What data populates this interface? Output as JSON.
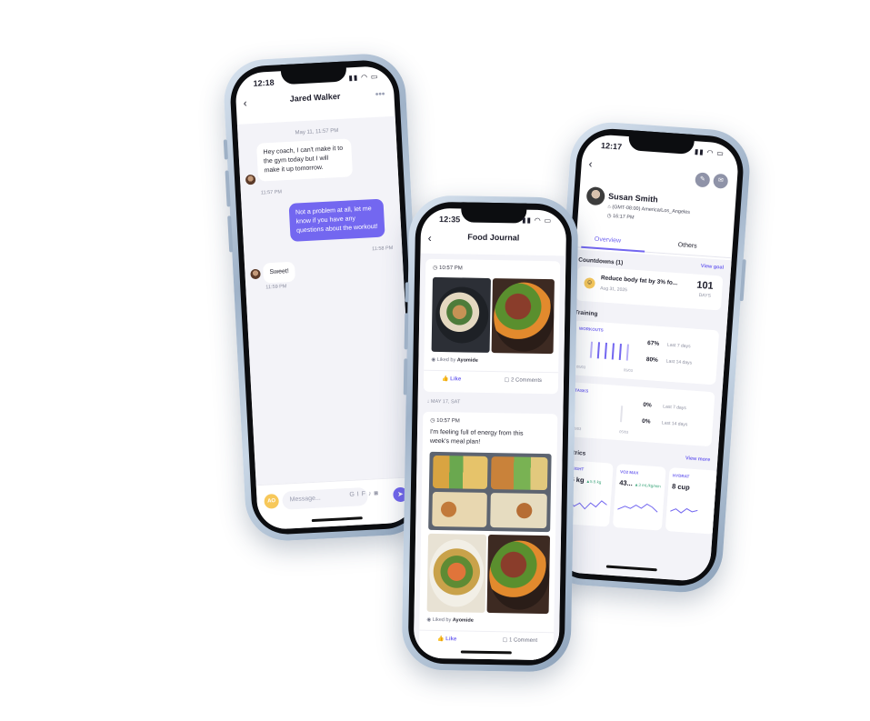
{
  "chat": {
    "time": "12:18",
    "title": "Jared Walker",
    "date": "May 11, 11:57 PM",
    "messages": [
      {
        "text": "Hey coach, I can't make it to the gym today but I will make it up tomorrow.",
        "time": "11:57 PM"
      },
      {
        "text": "Not a problem at all, let me know if you have any questions about the workout!",
        "time": "11:58 PM"
      },
      {
        "text": "Sweet!",
        "time": "11:59 PM"
      }
    ],
    "composer": {
      "initials": "AO",
      "placeholder": "Message..."
    }
  },
  "food": {
    "time": "12:35",
    "title": "Food Journal",
    "posts": [
      {
        "time": "10:57 PM",
        "liked_by_prefix": "Liked by",
        "liked_by": "Ayomide",
        "like": "Like",
        "comments": "2 Comments"
      },
      {
        "time": "10:57 PM",
        "caption": "I'm feeling full of energy from this week's meal plan!",
        "liked_by_prefix": "Liked by",
        "liked_by": "Ayomide",
        "like": "Like",
        "comments": "1 Comment"
      }
    ],
    "day_divider": "MAY 17, SAT"
  },
  "client": {
    "time": "12:17",
    "name": "Susan Smith",
    "timezone": "(GMT-08:00) America/Los_Angeles",
    "local_time": "16:17 PM",
    "tabs": [
      "Overview",
      "Others"
    ],
    "countdowns": {
      "title": "Countdowns (1)",
      "link": "View goal",
      "goal": "Reduce body fat by 3% fo...",
      "date": "Aug 31, 2025",
      "days": "101",
      "days_label": "DAYS"
    },
    "training": {
      "title": "Training",
      "workouts": {
        "label": "WORKOUTS",
        "rows": [
          {
            "pct": "67%",
            "period": "Last 7 days"
          },
          {
            "pct": "80%",
            "period": "Last 14 days"
          }
        ],
        "axis": [
          "05/03",
          "05/03"
        ]
      },
      "tasks": {
        "label": "TASKS",
        "rows": [
          {
            "pct": "0%",
            "period": "Last 7 days"
          },
          {
            "pct": "0%",
            "period": "Last 14 days"
          }
        ],
        "axis": [
          "05/03",
          "05/03"
        ]
      }
    },
    "metrics": {
      "title": "Metrics",
      "link": "View more",
      "items": [
        {
          "label": "WEIGHT",
          "value": "66 kg",
          "delta": "▲5.5 kg"
        },
        {
          "label": "VO2 MAX",
          "value": "43...",
          "delta": "▲3 mL/kg/min"
        },
        {
          "label": "HYDRAT",
          "value": "8 cup",
          "delta": ""
        }
      ]
    }
  },
  "colors": {
    "accent": "#7367f0",
    "background": "#f3f3f8"
  }
}
